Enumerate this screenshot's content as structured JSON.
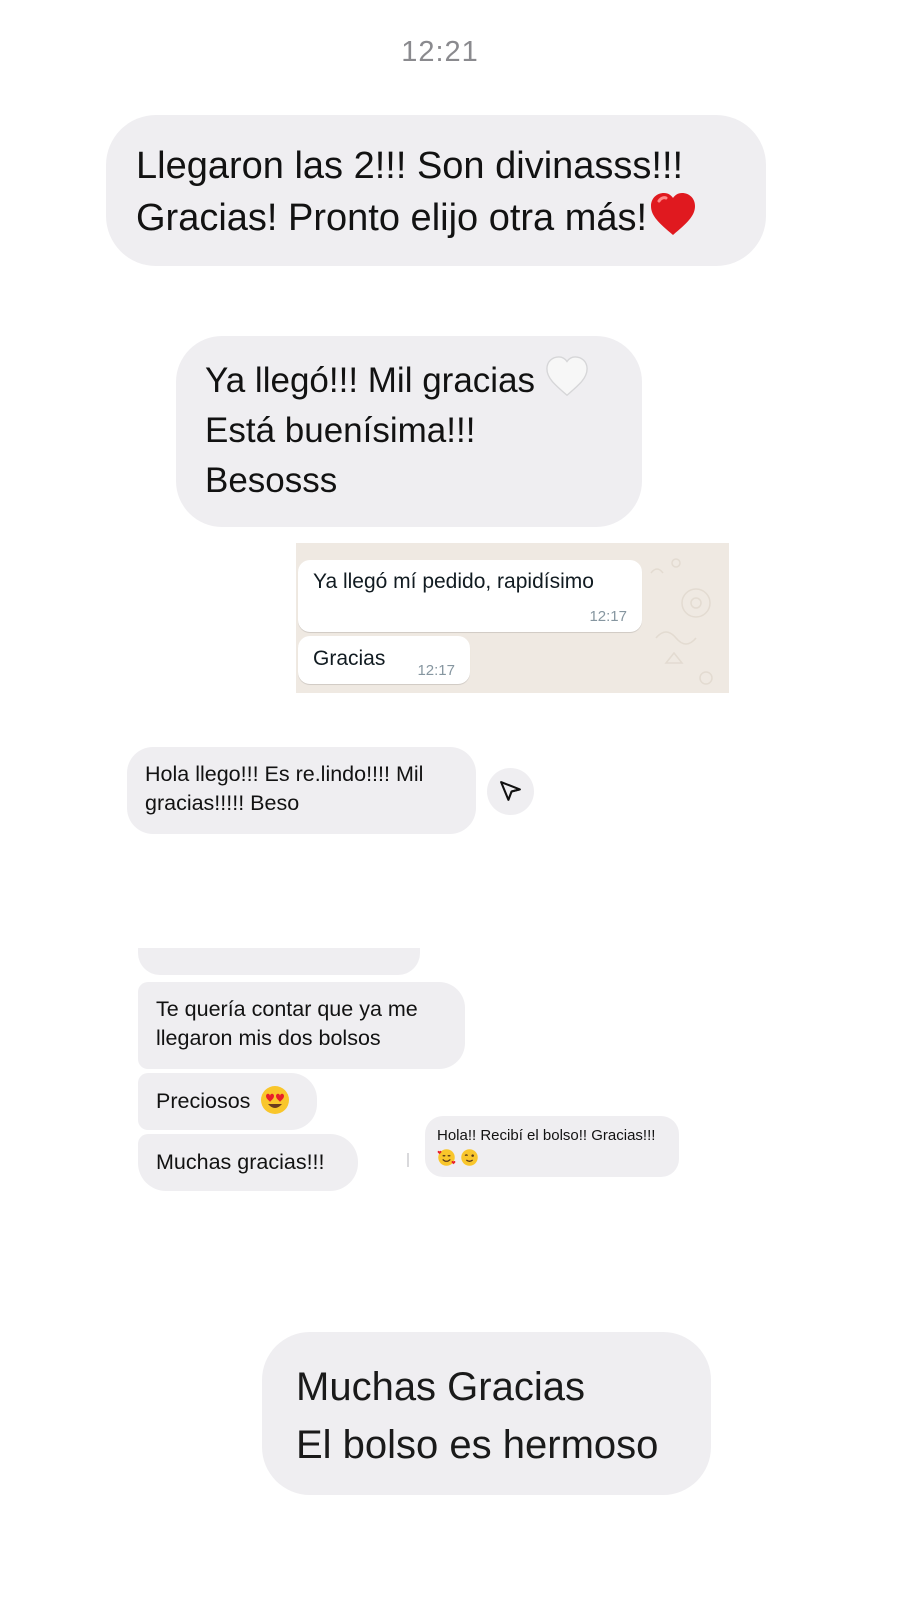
{
  "header": {
    "time": "12:21"
  },
  "bubble1": {
    "lines": [
      "Llegaron las 2!!! Son divinasss!!!",
      "Gracias! Pronto elijo otra más!"
    ],
    "emoji": "red-heart"
  },
  "bubble2": {
    "lines": [
      "Ya llegó!!! Mil gracias",
      "Está buenísima!!!",
      "Besosss"
    ],
    "emoji": "white-heart"
  },
  "whatsapp": {
    "messages": [
      {
        "text": "Ya llegó mí pedido, rapidísimo",
        "time": "12:17"
      },
      {
        "text": "Gracias",
        "time": "12:17"
      }
    ]
  },
  "instagram": {
    "lines": [
      "Hola llego!!! Es re.lindo!!!! Mil",
      "gracias!!!!! Beso"
    ],
    "share_icon": "send-arrow-icon"
  },
  "messenger": {
    "messages": [
      {
        "lines": [
          "Te quería contar que ya me",
          "llegaron mis dos bolsos"
        ]
      },
      {
        "lines": [
          "Preciosos"
        ],
        "emoji": "heart-eyes"
      },
      {
        "lines": [
          "Muchas gracias!!!"
        ]
      }
    ]
  },
  "small_chat": {
    "text": "Hola!! Recibí el bolso!! Gracias!!!",
    "emojis": [
      "smiling-face-with-hearts",
      "winking-face"
    ]
  },
  "final_bubble": {
    "lines": [
      "Muchas Gracias",
      "El bolso es hermoso"
    ]
  },
  "colors": {
    "bubble_gray": "#efeef1",
    "whatsapp_bg": "#efe9e2",
    "whatsapp_time": "#8696a0",
    "timestamp_gray": "#8a8a8e"
  }
}
